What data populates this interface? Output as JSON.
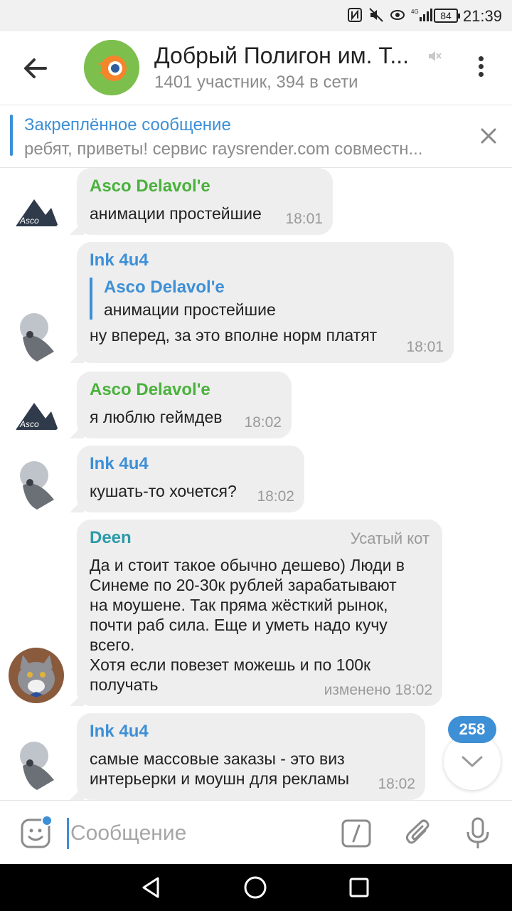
{
  "status_bar": {
    "battery": "84",
    "time": "21:39",
    "icons": [
      "nfc-icon",
      "mute-icon",
      "eye-icon",
      "signal-4g-icon"
    ]
  },
  "header": {
    "title": "Добрый Полигон им. Т...",
    "subtitle": "1401 участник, 394 в сети"
  },
  "pinned": {
    "title": "Закреплённое сообщение",
    "text": "ребят, приветы! сервис raysrender.com совместн..."
  },
  "messages": [
    {
      "sender": "Asco Delavol'e",
      "text": "анимации простейшие",
      "time": "18:01"
    },
    {
      "sender": "Ink 4u4",
      "reply_to": "Asco Delavol'e",
      "reply_text": "анимации простейшие",
      "text": "ну вперед, за это вполне норм платят",
      "time": "18:01"
    },
    {
      "sender": "Asco Delavol'e",
      "text": "я люблю геймдев",
      "time": "18:02"
    },
    {
      "sender": "Ink 4u4",
      "text": "кушать-то хочется?",
      "time": "18:02"
    },
    {
      "sender": "Deen",
      "role": "Усатый кот",
      "text_lines": [
        "Да и стоит такое обычно дешево) Люди в",
        "Синеме по 20-30к рублей зарабатывают",
        "на моушене. Так пряма жёсткий рынок,",
        "почти раб сила. Еще и уметь надо кучу",
        "всего.",
        "Хотя если повезет можешь и по 100к",
        "получать"
      ],
      "time": "изменено 18:02"
    },
    {
      "sender": "Ink 4u4",
      "text_lines": [
        "самые массовые заказы - это виз",
        "интерьерки и моушн для рекламы"
      ],
      "time": "18:02"
    }
  ],
  "unread_count": "258",
  "input": {
    "placeholder": "Сообщение"
  },
  "colors": {
    "accent": "#3d8fd6",
    "green_sender": "#4ab23c",
    "teal_sender": "#2c9aa8",
    "bubble": "#eeeeee"
  }
}
